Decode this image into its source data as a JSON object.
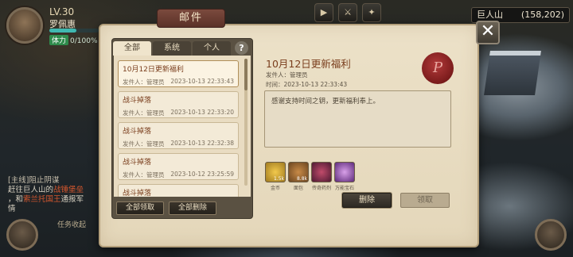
{
  "player": {
    "level": "LV.30",
    "name": "罗佩惠",
    "stamina_tag": "体力",
    "stamina": "0/100%"
  },
  "location": {
    "name": "巨人山",
    "coords": "(158,202)"
  },
  "quest": {
    "title": "[主线]阻止阴谋",
    "line1_a": "赶往巨人山的",
    "line1_b": "战锤堡垒",
    "line2_a": "，和",
    "line2_b": "索兰托国王",
    "line2_c": "通报军",
    "line3": "情",
    "collapse": "任务收起"
  },
  "mail": {
    "title": "邮件",
    "tabs": [
      "全部",
      "系统",
      "个人"
    ],
    "help": "?",
    "items": [
      {
        "title": "10月12日更新福利",
        "sender": "发件人：管理员",
        "time": "2023-10-13 22:33:43"
      },
      {
        "title": "战斗掉落",
        "sender": "发件人：管理员",
        "time": "2023-10-13 22:33:20"
      },
      {
        "title": "战斗掉落",
        "sender": "发件人：管理员",
        "time": "2023-10-13 22:32:38"
      },
      {
        "title": "战斗掉落",
        "sender": "发件人：管理员",
        "time": "2023-10-12 23:25:59"
      },
      {
        "title": "战斗掉落",
        "sender": "",
        "time": ""
      }
    ],
    "claim_all": "全部领取",
    "delete_all": "全部删除",
    "detail": {
      "title": "10月12日更新福利",
      "sender": "发件人：管理员",
      "time": "时间：2023-10-13 22:33:43",
      "seal_letter": "P",
      "content": "感谢支持时间之钥，更新福利奉上。",
      "rewards": [
        {
          "name": "金币",
          "count": "1.5k",
          "icon": "gold-coin-icon"
        },
        {
          "name": "面包",
          "count": "8.8k",
          "icon": "bread-icon"
        },
        {
          "name": "传奇药剂",
          "count": "",
          "icon": "potion-icon"
        },
        {
          "name": "万能宝石",
          "count": "",
          "icon": "gem-icon"
        }
      ],
      "delete": "删除",
      "claim": "领取"
    },
    "close": "✕"
  }
}
